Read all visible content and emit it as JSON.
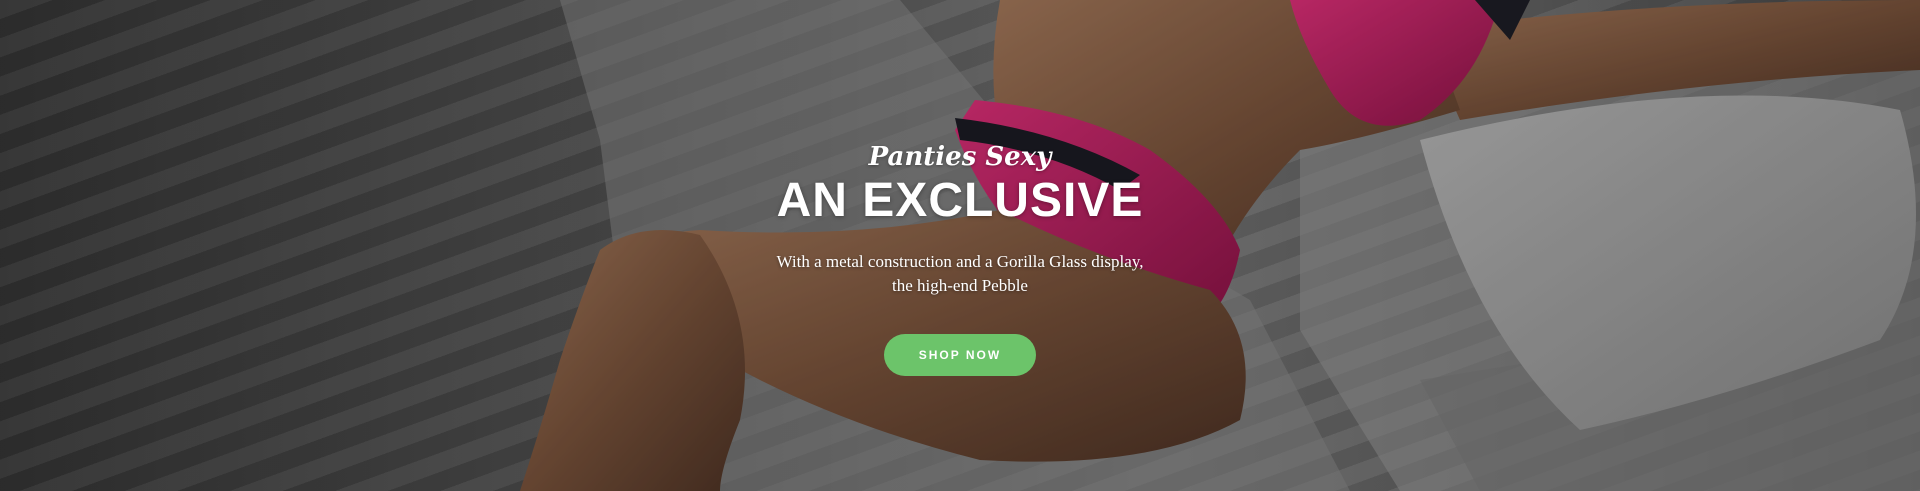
{
  "hero": {
    "subtitle": "Panties Sexy",
    "title": "AN EXCLUSIVE",
    "description_line1": "With a metal construction and a Gorilla Glass display,",
    "description_line2": "the high-end Pebble",
    "button_label": "SHOP NOW"
  },
  "colors": {
    "button_background": "#6cc46a",
    "text": "#ffffff",
    "lingerie_accent": "#c2185b"
  }
}
